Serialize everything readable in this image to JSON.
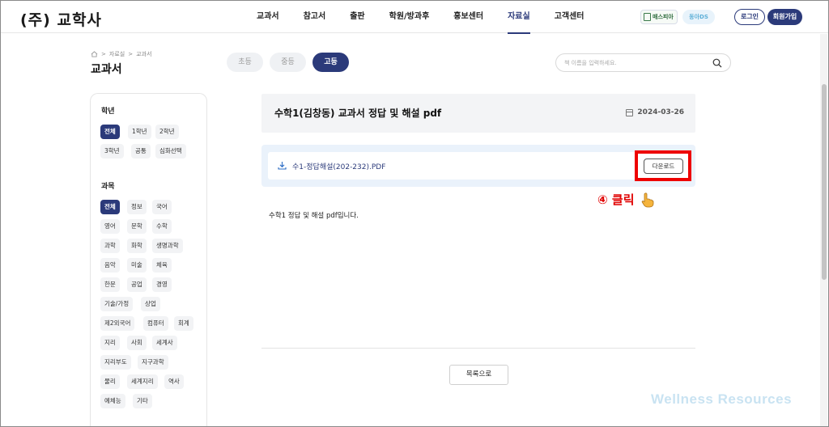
{
  "header": {
    "logo": "(주) 교학사",
    "nav": [
      {
        "label": "교과서",
        "active": false
      },
      {
        "label": "참고서",
        "active": false
      },
      {
        "label": "출판",
        "active": false
      },
      {
        "label": "학원/방과후",
        "active": false
      },
      {
        "label": "홍보센터",
        "active": false
      },
      {
        "label": "자료실",
        "active": true
      },
      {
        "label": "고객센터",
        "active": false
      }
    ],
    "badge_a": "매스피아",
    "badge_b": "동아DS",
    "login": "로그인",
    "join": "회원가입"
  },
  "breadcrumb": [
    "자료실",
    "교과서"
  ],
  "page_title": "교과서",
  "level_tabs": [
    {
      "label": "초등",
      "active": false
    },
    {
      "label": "중등",
      "active": false
    },
    {
      "label": "고등",
      "active": true
    }
  ],
  "search": {
    "placeholder": "책 이름을 입력하세요.",
    "value": ""
  },
  "filter": {
    "grade_label": "학년",
    "grades": [
      "전체",
      "1학년",
      "2학년",
      "3학년",
      "공통",
      "심화선택"
    ],
    "subject_label": "과목",
    "subjects": [
      "전체",
      "정보",
      "국어",
      "영어",
      "문학",
      "수학",
      "과학",
      "화학",
      "생명과학",
      "음악",
      "미술",
      "체육",
      "한문",
      "공업",
      "경영",
      "기술/가정",
      "상업",
      "제2외국어",
      "컴퓨터",
      "회계",
      "지리",
      "사회",
      "세계사",
      "지리부도",
      "지구과학",
      "물리",
      "세계지리",
      "역사",
      "예체능",
      "기타"
    ]
  },
  "post": {
    "title": "수학1(김창동) 교과서 정답 및 해설 pdf",
    "date": "2024-03-26",
    "attachment": "수1-정답해설(202-232).PDF",
    "download_label": "다운로드",
    "body": "수학1 정답 및 해설 pdf입니다.",
    "list_label": "목록으로"
  },
  "annotation": "④ 클릭",
  "watermark": "Wellness Resources",
  "colors": {
    "accent": "#2b3a7a",
    "highlight": "#ee0000",
    "watermark": "#c9e3f2"
  }
}
